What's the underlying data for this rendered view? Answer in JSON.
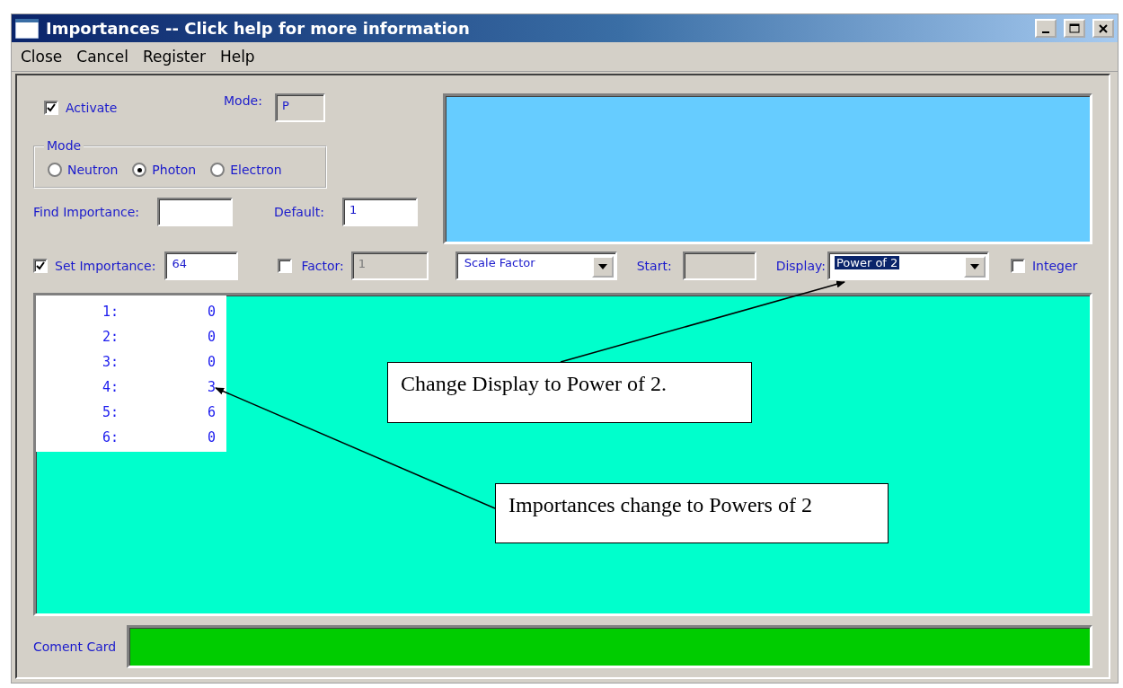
{
  "window": {
    "title": "Importances -- Click help for more information"
  },
  "menu": [
    "Close",
    "Cancel",
    "Register",
    "Help"
  ],
  "activate": {
    "label": "Activate",
    "checked": true
  },
  "mode_field": {
    "label": "Mode:",
    "value": "P"
  },
  "mode_group": {
    "title": "Mode",
    "options": [
      {
        "label": "Neutron",
        "selected": false
      },
      {
        "label": "Photon",
        "selected": true
      },
      {
        "label": "Electron",
        "selected": false
      }
    ]
  },
  "find_importance": {
    "label": "Find Importance:"
  },
  "default": {
    "label": "Default:",
    "value": "1"
  },
  "set_importance": {
    "label": "Set Importance:",
    "checked": true,
    "value": "64"
  },
  "factor": {
    "label": "Factor:",
    "checked": false,
    "value": "1",
    "disabled": true
  },
  "scale_select": {
    "value": "Scale Factor"
  },
  "start": {
    "label": "Start:"
  },
  "display": {
    "label": "Display:",
    "value": "Power of 2"
  },
  "integer": {
    "label": "Integer",
    "checked": false
  },
  "importances": [
    {
      "index": "1:",
      "value": "0"
    },
    {
      "index": "2:",
      "value": "0"
    },
    {
      "index": "3:",
      "value": "0"
    },
    {
      "index": "4:",
      "value": "3"
    },
    {
      "index": "5:",
      "value": "6"
    },
    {
      "index": "6:",
      "value": "0"
    }
  ],
  "comment_card": {
    "label": "Coment Card"
  },
  "annotations": [
    {
      "text": "Change Display to Power of 2."
    },
    {
      "text": "Importances change to Powers of 2"
    }
  ]
}
